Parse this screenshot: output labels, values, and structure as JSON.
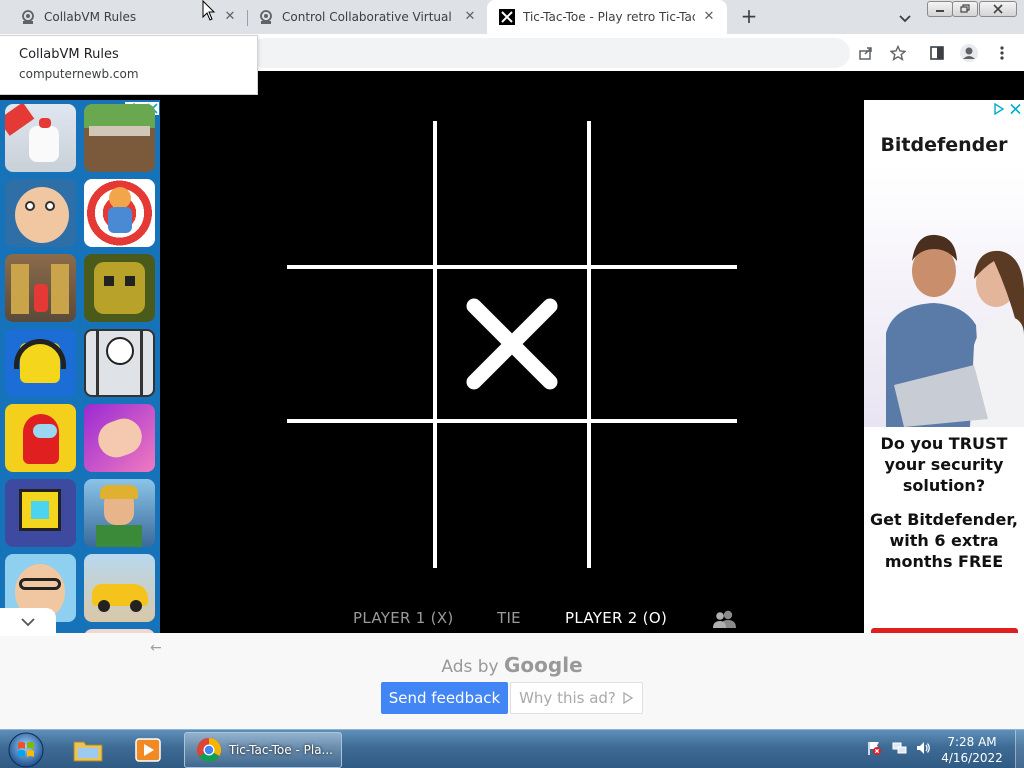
{
  "browser": {
    "tabs": [
      {
        "title": "CollabVM Rules",
        "icon": "collabvm-icon"
      },
      {
        "title": "Control Collaborative Virtual Mac",
        "icon": "collabvm-icon"
      },
      {
        "title": "Tic-Tac-Toe - Play retro Tic-Tac-To",
        "icon": "x-logo-icon"
      }
    ],
    "new_tab_label": "+",
    "close_glyph": "✕"
  },
  "hover_card": {
    "title": "CollabVM Rules",
    "domain": "computernewb.com"
  },
  "game": {
    "board": [
      "",
      "",
      "",
      "",
      "X",
      "",
      "",
      "",
      ""
    ],
    "player1_label": "PLAYER 1 (X)",
    "tie_label": "TIE",
    "player2_label": "PLAYER 2 (O)",
    "active_player": 2,
    "mode_icon": "two-players-icon"
  },
  "left_ad": {
    "games": [
      "best-chicken",
      "minecraft",
      "cartoon-face",
      "kick-the-buddy",
      "subway-surfers",
      "temple-run",
      "geometry-headphones",
      "stickman-prison",
      "among-us",
      "nail-art",
      "geometry-dash",
      "fortnite",
      "grumpy-face",
      "car-racing"
    ]
  },
  "right_ad": {
    "brand": "Bitdefender",
    "question": "Do you TRUST your security solution?",
    "offer": "Get Bitdefender, with 6 extra months FREE"
  },
  "ad_closed": {
    "ads_by_prefix": "Ads by",
    "ads_by_brand": "Google",
    "send_feedback": "Send feedback",
    "why_this_ad": "Why this ad?"
  },
  "taskbar": {
    "active_task_title": "Tic-Tac-Toe - Pla...",
    "time": "7:28 AM",
    "date": "4/16/2022"
  },
  "colors": {
    "board_bg": "#000000",
    "grid": "#ffffff",
    "feedback_button": "#4285f4",
    "left_ad_bg": "#1673b9",
    "taskbar": "#3e6b95"
  }
}
